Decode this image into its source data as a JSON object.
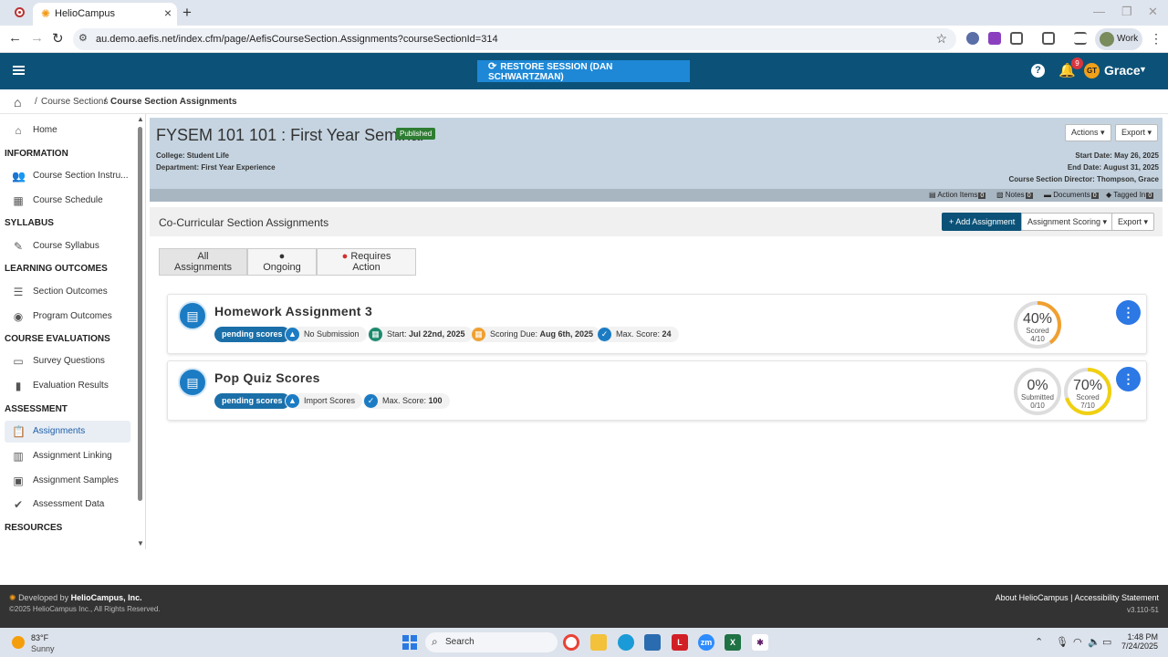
{
  "browser": {
    "tab_title": "HelioCampus",
    "url": "au.demo.aefis.net/index.cfm/page/AefisCourseSection.Assignments?courseSectionId=314",
    "profile_label": "Work"
  },
  "header": {
    "restore_label": "RESTORE SESSION (DAN SCHWARTZMAN)",
    "notification_count": "9",
    "avatar_initials": "GT",
    "user_name": "Grace"
  },
  "breadcrumb": {
    "items": [
      "Course Sections",
      "Course Section Assignments"
    ]
  },
  "sidebar": {
    "home": "Home",
    "sections": [
      {
        "title": "INFORMATION",
        "items": [
          "Course Section Instru...",
          "Course Schedule"
        ]
      },
      {
        "title": "SYLLABUS",
        "items": [
          "Course Syllabus"
        ]
      },
      {
        "title": "LEARNING OUTCOMES",
        "items": [
          "Section Outcomes",
          "Program Outcomes"
        ]
      },
      {
        "title": "COURSE EVALUATIONS",
        "items": [
          "Survey Questions",
          "Evaluation Results"
        ]
      },
      {
        "title": "ASSESSMENT",
        "items": [
          "Assignments",
          "Assignment Linking",
          "Assignment Samples",
          "Assessment Data"
        ]
      },
      {
        "title": "RESOURCES",
        "items": []
      }
    ],
    "active_item": "Assignments"
  },
  "course": {
    "title": "FYSEM 101 101 : First Year Seminar",
    "status": "Published",
    "college": "College: Student Life",
    "department": "Department: First Year Experience",
    "start_date": "Start Date: May 26, 2025",
    "end_date": "End Date: August 31, 2025",
    "director": "Course Section Director: Thompson, Grace",
    "actions_label": "Actions",
    "export_label": "Export",
    "bar": {
      "action_items": "Action Items",
      "action_items_count": "0",
      "notes": "Notes",
      "notes_count": "0",
      "documents": "Documents",
      "documents_count": "0",
      "tagged_in": "Tagged In",
      "tagged_in_count": "0"
    }
  },
  "section": {
    "title": "Co-Curricular Section Assignments",
    "add_label": "+ Add Assignment",
    "scoring_label": "Assignment Scoring",
    "export_label": "Export"
  },
  "filters": {
    "all": "All Assignments",
    "ongoing": "Ongoing",
    "requires_action": "Requires Action"
  },
  "assignments": [
    {
      "title": "Homework Assignment 3",
      "status": "pending scores",
      "submission": "No Submission",
      "start_label": "Start:",
      "start_value": "Jul 22nd, 2025",
      "due_label": "Scoring Due:",
      "due_value": "Aug 6th, 2025",
      "max_label": "Max. Score:",
      "max_value": "24",
      "gauges": [
        {
          "pct": "40%",
          "label": "Scored",
          "count": "4/10",
          "fraction": 0.4,
          "color": "#f0a030"
        }
      ]
    },
    {
      "title": "Pop Quiz Scores",
      "status": "pending scores",
      "submission": "Import Scores",
      "max_label": "Max. Score:",
      "max_value": "100",
      "gauges": [
        {
          "pct": "0%",
          "label": "Submitted",
          "count": "0/10",
          "fraction": 0.0,
          "color": "#bbbbbb"
        },
        {
          "pct": "70%",
          "label": "Scored",
          "count": "7/10",
          "fraction": 0.7,
          "color": "#f0d010"
        }
      ]
    }
  ],
  "footer": {
    "developed_prefix": "Developed by",
    "developed_by": "HelioCampus, Inc.",
    "copyright": "©2025 HelioCampus Inc., All Rights Reserved.",
    "about": "About HelioCampus",
    "accessibility": "Accessibility Statement",
    "version": "v3.110-51"
  },
  "taskbar": {
    "temp": "83°F",
    "weather": "Sunny",
    "search_label": "Search",
    "time": "1:48 PM",
    "date": "7/24/2025"
  }
}
